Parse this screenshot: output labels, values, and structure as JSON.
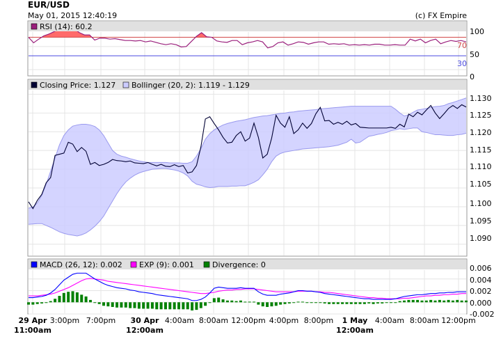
{
  "header": {
    "symbol": "EUR/USD",
    "datetime": "May 01, 2015 12:40:19",
    "copyright": "(c) FX Empire"
  },
  "colors": {
    "rsi_line": "#9a1f7c",
    "rsi_fill": "#ff6a6a",
    "rsi_upper_level": "#d24a4a",
    "rsi_lower_level": "#4a4ae0",
    "closing_price": "#000033",
    "bollinger_fill": "#ccccff",
    "bollinger_stroke": "#9999ee",
    "macd": "#0000ff",
    "exp": "#ff00ff",
    "divergence": "#008000",
    "legend_bg": "#e0e0e0",
    "grid": "#e4e4e4"
  },
  "x_labels": [
    {
      "top": "29 Apr",
      "bottom": "11:00am",
      "bold": true
    },
    {
      "top": "3:00pm",
      "bold": false
    },
    {
      "top": "7:00pm",
      "bold": false
    },
    {
      "top": "30 Apr",
      "bottom": "12:00am",
      "bold": true
    },
    {
      "top": "4:00am",
      "bold": false
    },
    {
      "top": "8:00am",
      "bold": false
    },
    {
      "top": "12:00pm",
      "bold": false
    },
    {
      "top": "4:00pm",
      "bold": false
    },
    {
      "top": "8:00pm",
      "bold": false
    },
    {
      "top": "1 May",
      "bottom": "12:00am",
      "bold": true
    },
    {
      "top": "4:00am",
      "bold": false
    },
    {
      "top": "8:00am",
      "bold": false
    },
    {
      "top": "12:00pm",
      "bold": false
    }
  ],
  "chart_data": [
    {
      "type": "line",
      "title": "RSI (14): 60.2",
      "series": [
        {
          "name": "RSI (14): 60.2",
          "values": [
            70,
            58,
            66,
            73,
            77,
            82,
            88,
            88,
            89,
            88,
            80,
            75,
            75,
            64,
            68,
            68,
            66,
            67,
            65,
            63,
            63,
            62,
            63,
            60,
            62,
            59,
            56,
            54,
            56,
            54,
            49,
            50,
            61,
            72,
            80,
            71,
            70,
            62,
            60,
            59,
            63,
            63,
            54,
            58,
            60,
            63,
            60,
            47,
            50,
            58,
            60,
            53,
            56,
            60,
            59,
            55,
            58,
            60,
            60,
            55,
            56,
            55,
            56,
            53,
            54,
            53,
            54,
            53,
            55,
            55,
            53,
            53,
            54,
            53,
            53,
            66,
            62,
            66,
            58,
            63,
            66,
            56,
            60,
            63,
            61,
            63,
            60
          ]
        }
      ],
      "levels": [
        70,
        30
      ],
      "level_labels": [
        "70",
        "30"
      ],
      "yticks": [
        "100",
        "50",
        "0"
      ],
      "ylim": [
        0,
        110
      ]
    },
    {
      "type": "line",
      "series": [
        {
          "name": "Closing Price: 1.127",
          "values": [
            1.1013,
            1.0995,
            1.1017,
            1.1033,
            1.1064,
            1.1078,
            1.1137,
            1.114,
            1.1143,
            1.1172,
            1.1167,
            1.1147,
            1.1158,
            1.1148,
            1.1113,
            1.1118,
            1.111,
            1.1113,
            1.1118,
            1.1126,
            1.1123,
            1.1122,
            1.112,
            1.1122,
            1.1117,
            1.1116,
            1.1115,
            1.1118,
            1.1113,
            1.1109,
            1.1113,
            1.1108,
            1.1107,
            1.1112,
            1.1107,
            1.111,
            1.109,
            1.1093,
            1.111,
            1.116,
            1.1234,
            1.124,
            1.1222,
            1.1205,
            1.1185,
            1.117,
            1.1172,
            1.119,
            1.12,
            1.1175,
            1.1183,
            1.1223,
            1.1185,
            1.113,
            1.114,
            1.1183,
            1.1244,
            1.1223,
            1.1212,
            1.124,
            1.1195,
            1.1205,
            1.1223,
            1.1209,
            1.1222,
            1.1248,
            1.1265,
            1.1229,
            1.123,
            1.122,
            1.1225,
            1.122,
            1.1228,
            1.1218,
            1.1222,
            1.1212,
            1.1211,
            1.121,
            1.121,
            1.121,
            1.121,
            1.121,
            1.1212,
            1.1209,
            1.122,
            1.1213,
            1.1247,
            1.124,
            1.1252,
            1.1245,
            1.1258,
            1.127,
            1.125,
            1.1235,
            1.1248,
            1.1262,
            1.127,
            1.1262,
            1.1272,
            1.1266
          ]
        },
        {
          "name": "Bollinger upper",
          "values": [
            1.0996,
            1.0999,
            1.101,
            1.103,
            1.106,
            1.1095,
            1.113,
            1.1165,
            1.119,
            1.1205,
            1.1215,
            1.1218,
            1.122,
            1.122,
            1.1218,
            1.1214,
            1.1205,
            1.119,
            1.117,
            1.115,
            1.114,
            1.1135,
            1.1132,
            1.1128,
            1.1125,
            1.1122,
            1.112,
            1.1118,
            1.1118,
            1.1118,
            1.1118,
            1.1118,
            1.1117,
            1.1117,
            1.1117,
            1.1116,
            1.1116,
            1.112,
            1.1135,
            1.1155,
            1.118,
            1.1195,
            1.1205,
            1.1212,
            1.1218,
            1.1222,
            1.1225,
            1.1228,
            1.123,
            1.1232,
            1.1235,
            1.1238,
            1.124,
            1.1242,
            1.1243,
            1.1245,
            1.1247,
            1.1249,
            1.125,
            1.1252,
            1.1253,
            1.1255,
            1.1256,
            1.1257,
            1.1258,
            1.1259,
            1.1261,
            1.1262,
            1.1263,
            1.1264,
            1.1265,
            1.1266,
            1.1267,
            1.1268,
            1.1268,
            1.1268,
            1.1268,
            1.1268,
            1.1268,
            1.1268,
            1.1268,
            1.1268,
            1.1268,
            1.126,
            1.125,
            1.1242,
            1.1245,
            1.1252,
            1.1258,
            1.126,
            1.1262,
            1.1265,
            1.1267,
            1.1268,
            1.127,
            1.1275,
            1.1278,
            1.1282,
            1.1286,
            1.129
          ]
        },
        {
          "name": "Bollinger lower",
          "values": [
            1.0953,
            1.0954,
            1.0955,
            1.0955,
            1.095,
            1.0945,
            1.0939,
            1.0933,
            1.0929,
            1.0926,
            1.0924,
            1.0922,
            1.0925,
            1.093,
            1.0938,
            1.0948,
            1.096,
            1.0975,
            1.0995,
            1.1015,
            1.1035,
            1.1052,
            1.1066,
            1.1076,
            1.1084,
            1.109,
            1.1094,
            1.1097,
            1.11,
            1.1101,
            1.1102,
            1.1102,
            1.11,
            1.1098,
            1.1095,
            1.109,
            1.1082,
            1.1068,
            1.106,
            1.1057,
            1.1053,
            1.1051,
            1.1052,
            1.1054,
            1.1054,
            1.1054,
            1.1055,
            1.1055,
            1.1056,
            1.1056,
            1.106,
            1.1065,
            1.1072,
            1.1085,
            1.11,
            1.112,
            1.1135,
            1.1142,
            1.1146,
            1.1148,
            1.115,
            1.1152,
            1.1154,
            1.1155,
            1.1156,
            1.1157,
            1.1158,
            1.1159,
            1.116,
            1.1162,
            1.1164,
            1.1168,
            1.1172,
            1.118,
            1.117,
            1.1172,
            1.118,
            1.1188,
            1.119,
            1.1193,
            1.1195,
            1.1198,
            1.1203,
            1.1205,
            1.1208,
            1.1206,
            1.1208,
            1.121,
            1.121,
            1.12,
            1.1198,
            1.1195,
            1.1192,
            1.1192,
            1.1191,
            1.119,
            1.119,
            1.1192,
            1.1193,
            1.1196
          ]
        }
      ],
      "legend": [
        "Closing Price: 1.127",
        "Bollinger (20, 2): 1.119 - 1.129"
      ],
      "yticks": [
        "1.130",
        "1.125",
        "1.120",
        "1.115",
        "1.110",
        "1.105",
        "1.100",
        "1.095",
        "1.090"
      ],
      "ylim": [
        1.087,
        1.131
      ]
    },
    {
      "type": "line",
      "series": [
        {
          "name": "MACD (26, 12): 0.002",
          "values": [
            0.0008,
            0.0008,
            0.0009,
            0.001,
            0.0012,
            0.0016,
            0.0022,
            0.003,
            0.0038,
            0.0043,
            0.0048,
            0.005,
            0.005,
            0.005,
            0.0045,
            0.004,
            0.0036,
            0.0032,
            0.0029,
            0.0027,
            0.0025,
            0.0024,
            0.0023,
            0.0021,
            0.002,
            0.0018,
            0.0017,
            0.0016,
            0.0015,
            0.0013,
            0.0012,
            0.0011,
            0.001,
            0.0009,
            0.0008,
            0.0007,
            0.0006,
            0.0003,
            0.0003,
            0.0005,
            0.0009,
            0.0016,
            0.0024,
            0.0026,
            0.0025,
            0.0024,
            0.0024,
            0.0024,
            0.0025,
            0.0024,
            0.0024,
            0.0024,
            0.0018,
            0.0014,
            0.0012,
            0.0012,
            0.0012,
            0.0014,
            0.0015,
            0.0016,
            0.0018,
            0.002,
            0.002,
            0.0019,
            0.0019,
            0.0018,
            0.0017,
            0.0015,
            0.0014,
            0.0013,
            0.0012,
            0.0011,
            0.001,
            0.0009,
            0.0008,
            0.0007,
            0.0006,
            0.0006,
            0.0005,
            0.0005,
            0.0005,
            0.0005,
            0.0005,
            0.0006,
            0.0008,
            0.001,
            0.0011,
            0.0012,
            0.0013,
            0.0013,
            0.0014,
            0.0015,
            0.0015,
            0.0016,
            0.0016,
            0.0017,
            0.0017,
            0.0018,
            0.0018,
            0.0018
          ]
        },
        {
          "name": "EXP (9): 0.001",
          "values": [
            0.0011,
            0.0011,
            0.0011,
            0.0012,
            0.0013,
            0.0014,
            0.0016,
            0.0019,
            0.0022,
            0.0025,
            0.0029,
            0.0033,
            0.0037,
            0.004,
            0.0041,
            0.004,
            0.0039,
            0.0038,
            0.0036,
            0.0035,
            0.0034,
            0.0033,
            0.0032,
            0.0031,
            0.003,
            0.0029,
            0.0028,
            0.0027,
            0.0026,
            0.0025,
            0.0024,
            0.0023,
            0.0022,
            0.0021,
            0.002,
            0.0019,
            0.0018,
            0.0017,
            0.0016,
            0.0015,
            0.0015,
            0.0016,
            0.0017,
            0.0019,
            0.002,
            0.0021,
            0.0021,
            0.0022,
            0.0022,
            0.0023,
            0.0023,
            0.0023,
            0.0022,
            0.0021,
            0.002,
            0.0019,
            0.0018,
            0.0018,
            0.0018,
            0.0018,
            0.0018,
            0.0019,
            0.0019,
            0.0019,
            0.0019,
            0.0018,
            0.0018,
            0.0017,
            0.0017,
            0.0016,
            0.0015,
            0.0014,
            0.0013,
            0.0012,
            0.0011,
            0.001,
            0.0009,
            0.0008,
            0.0008,
            0.0007,
            0.0007,
            0.0006,
            0.0006,
            0.0006,
            0.0006,
            0.0007,
            0.0007,
            0.0008,
            0.0009,
            0.001,
            0.0011,
            0.0011,
            0.0012,
            0.0012,
            0.0013,
            0.0013,
            0.0014,
            0.0014,
            0.0015,
            0.0015
          ]
        },
        {
          "name": "Divergence: 0",
          "values": [
            -0.0004,
            -0.0004,
            -0.0003,
            -0.0002,
            -0.0001,
            0.0002,
            0.0006,
            0.0011,
            0.0016,
            0.0018,
            0.0019,
            0.0017,
            0.0013,
            0.001,
            0.0004,
            0.0,
            -0.0003,
            -0.0006,
            -0.0007,
            -0.0008,
            -0.0009,
            -0.0009,
            -0.0009,
            -0.001,
            -0.001,
            -0.0011,
            -0.0011,
            -0.0011,
            -0.0011,
            -0.0012,
            -0.0012,
            -0.0012,
            -0.0012,
            -0.0012,
            -0.0012,
            -0.0012,
            -0.0012,
            -0.0014,
            -0.0013,
            -0.001,
            -0.0006,
            0.0,
            0.0007,
            0.0008,
            0.0005,
            0.0003,
            0.0003,
            0.0002,
            0.0003,
            0.0001,
            0.0001,
            0.0001,
            -0.0004,
            -0.0007,
            -0.0008,
            -0.0007,
            -0.0006,
            -0.0004,
            -0.0003,
            -0.0002,
            0.0,
            0.0001,
            0.0001,
            0.0,
            0.0,
            0.0,
            -0.0001,
            -0.0002,
            -0.0003,
            -0.0003,
            -0.0003,
            -0.0003,
            -0.0003,
            -0.0003,
            -0.0003,
            -0.0003,
            -0.0003,
            -0.0002,
            -0.0003,
            -0.0002,
            -0.0002,
            -0.0001,
            -0.0001,
            0.0,
            0.0002,
            0.0003,
            0.0004,
            0.0004,
            0.0004,
            0.0003,
            0.0003,
            0.0004,
            0.0003,
            0.0004,
            0.0003,
            0.0004,
            0.0003,
            0.0004,
            0.0003,
            0.0003
          ]
        }
      ],
      "legend": [
        "MACD (26, 12): 0.002",
        "EXP (9): 0.001",
        "Divergence: 0"
      ],
      "yticks": [
        "0.006",
        "0.004",
        "0.002",
        "0.000",
        "-0.002"
      ],
      "ylim": [
        -0.002,
        0.006
      ]
    }
  ]
}
